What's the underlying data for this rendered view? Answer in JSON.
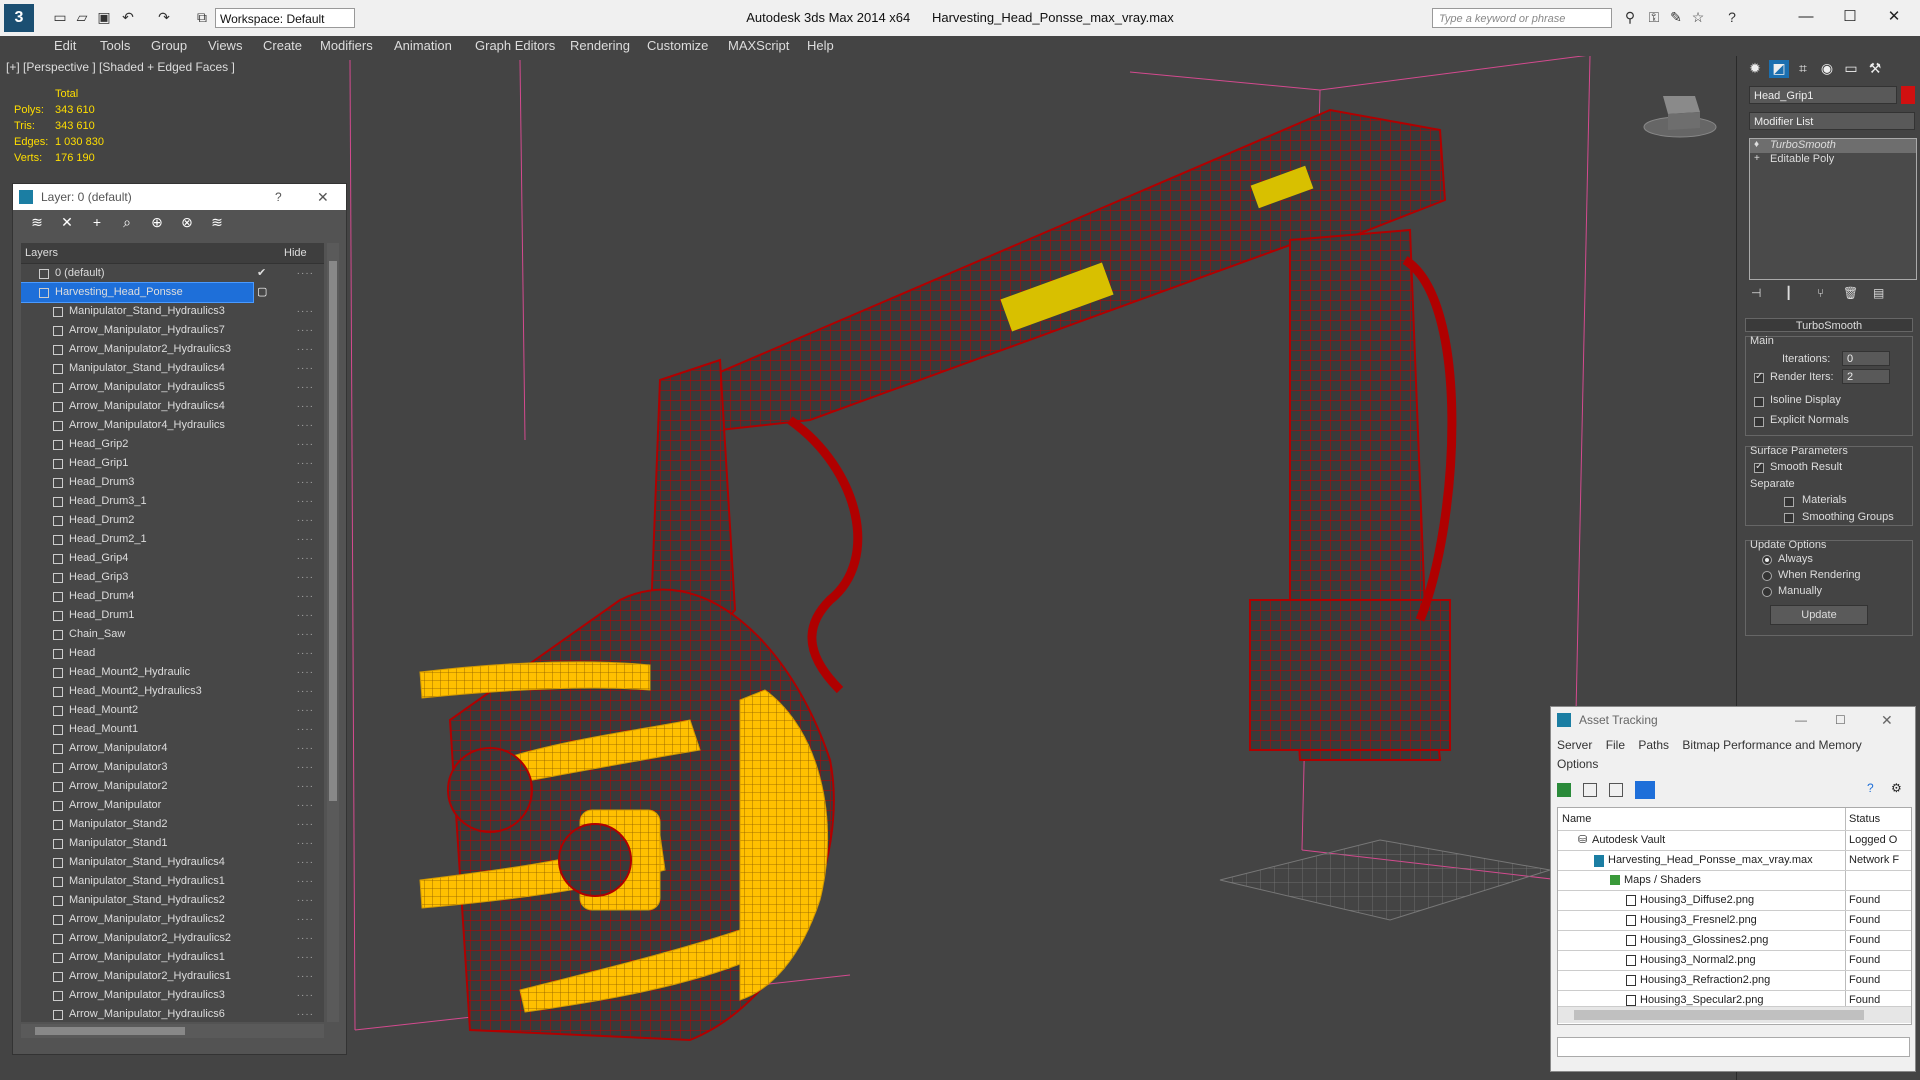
{
  "app": {
    "title": "Autodesk 3ds Max  2014 x64",
    "file": "Harvesting_Head_Ponsse_max_vray.max",
    "workspace": "Workspace: Default",
    "search_placeholder": "Type a keyword or phrase"
  },
  "menu": [
    "Edit",
    "Tools",
    "Group",
    "Views",
    "Create",
    "Modifiers",
    "Animation",
    "Graph Editors",
    "Rendering",
    "Customize",
    "MAXScript",
    "Help"
  ],
  "viewport": {
    "label": "[+] [Perspective ] [Shaded + Edged Faces ]",
    "stats": {
      "header": "Total",
      "rows": [
        {
          "k": "Polys:",
          "v": "343 610"
        },
        {
          "k": "Tris:",
          "v": "343 610"
        },
        {
          "k": "Edges:",
          "v": "1 030 830"
        },
        {
          "k": "Verts:",
          "v": "176 190"
        }
      ]
    }
  },
  "layer_explorer": {
    "title": "Layer: 0 (default)",
    "help": "?",
    "col_layers": "Layers",
    "col_hide": "Hide",
    "rows": [
      "0 (default)",
      "Harvesting_Head_Ponsse",
      "Manipulator_Stand_Hydraulics3",
      "Arrow_Manipulator_Hydraulics7",
      "Arrow_Manipulator2_Hydraulics3",
      "Manipulator_Stand_Hydraulics4",
      "Arrow_Manipulator_Hydraulics5",
      "Arrow_Manipulator_Hydraulics4",
      "Arrow_Manipulator4_Hydraulics",
      "Head_Grip2",
      "Head_Grip1",
      "Head_Drum3",
      "Head_Drum3_1",
      "Head_Drum2",
      "Head_Drum2_1",
      "Head_Grip4",
      "Head_Grip3",
      "Head_Drum4",
      "Head_Drum1",
      "Chain_Saw",
      "Head",
      "Head_Mount2_Hydraulic",
      "Head_Mount2_Hydraulics3",
      "Head_Mount2",
      "Head_Mount1",
      "Arrow_Manipulator4",
      "Arrow_Manipulator3",
      "Arrow_Manipulator2",
      "Arrow_Manipulator",
      "Manipulator_Stand2",
      "Manipulator_Stand1",
      "Manipulator_Stand_Hydraulics4",
      "Manipulator_Stand_Hydraulics1",
      "Manipulator_Stand_Hydraulics2",
      "Arrow_Manipulator_Hydraulics2",
      "Arrow_Manipulator2_Hydraulics2",
      "Arrow_Manipulator_Hydraulics1",
      "Arrow_Manipulator2_Hydraulics1",
      "Arrow_Manipulator_Hydraulics3",
      "Arrow_Manipulator_Hydraulics6"
    ]
  },
  "command_panel": {
    "object_name": "Head_Grip1",
    "modifier_list": "Modifier List",
    "stack": [
      "TurboSmooth",
      "Editable Poly"
    ],
    "turbosmooth": {
      "title": "TurboSmooth",
      "main": "Main",
      "iterations_label": "Iterations:",
      "iterations": "0",
      "render_iters_label": "Render Iters:",
      "render_iters": "2",
      "isoline": "Isoline Display",
      "explicit": "Explicit Normals",
      "surface": "Surface Parameters",
      "smooth": "Smooth Result",
      "separate": "Separate",
      "materials": "Materials",
      "smoothing": "Smoothing Groups",
      "update_opts": "Update Options",
      "always": "Always",
      "when_rendering": "When Rendering",
      "manually": "Manually",
      "update": "Update"
    }
  },
  "asset_tracking": {
    "title": "Asset Tracking",
    "menu": [
      "Server",
      "File",
      "Paths",
      "Bitmap Performance and Memory"
    ],
    "menu2": "Options",
    "col_name": "Name",
    "col_status": "Status",
    "rows": [
      {
        "name": "Autodesk Vault",
        "status": "Logged O"
      },
      {
        "name": "Harvesting_Head_Ponsse_max_vray.max",
        "status": "Network F"
      },
      {
        "name": "Maps / Shaders",
        "status": ""
      },
      {
        "name": "Housing3_Diffuse2.png",
        "status": "Found"
      },
      {
        "name": "Housing3_Fresnel2.png",
        "status": "Found"
      },
      {
        "name": "Housing3_Glossines2.png",
        "status": "Found"
      },
      {
        "name": "Housing3_Normal2.png",
        "status": "Found"
      },
      {
        "name": "Housing3_Refraction2.png",
        "status": "Found"
      },
      {
        "name": "Housing3_Specular2.png",
        "status": "Found"
      }
    ]
  },
  "colors": {
    "wire": "#b00000",
    "yellow": "#ffc000",
    "stats": "#ffde00",
    "select": "#1e6fd9"
  }
}
